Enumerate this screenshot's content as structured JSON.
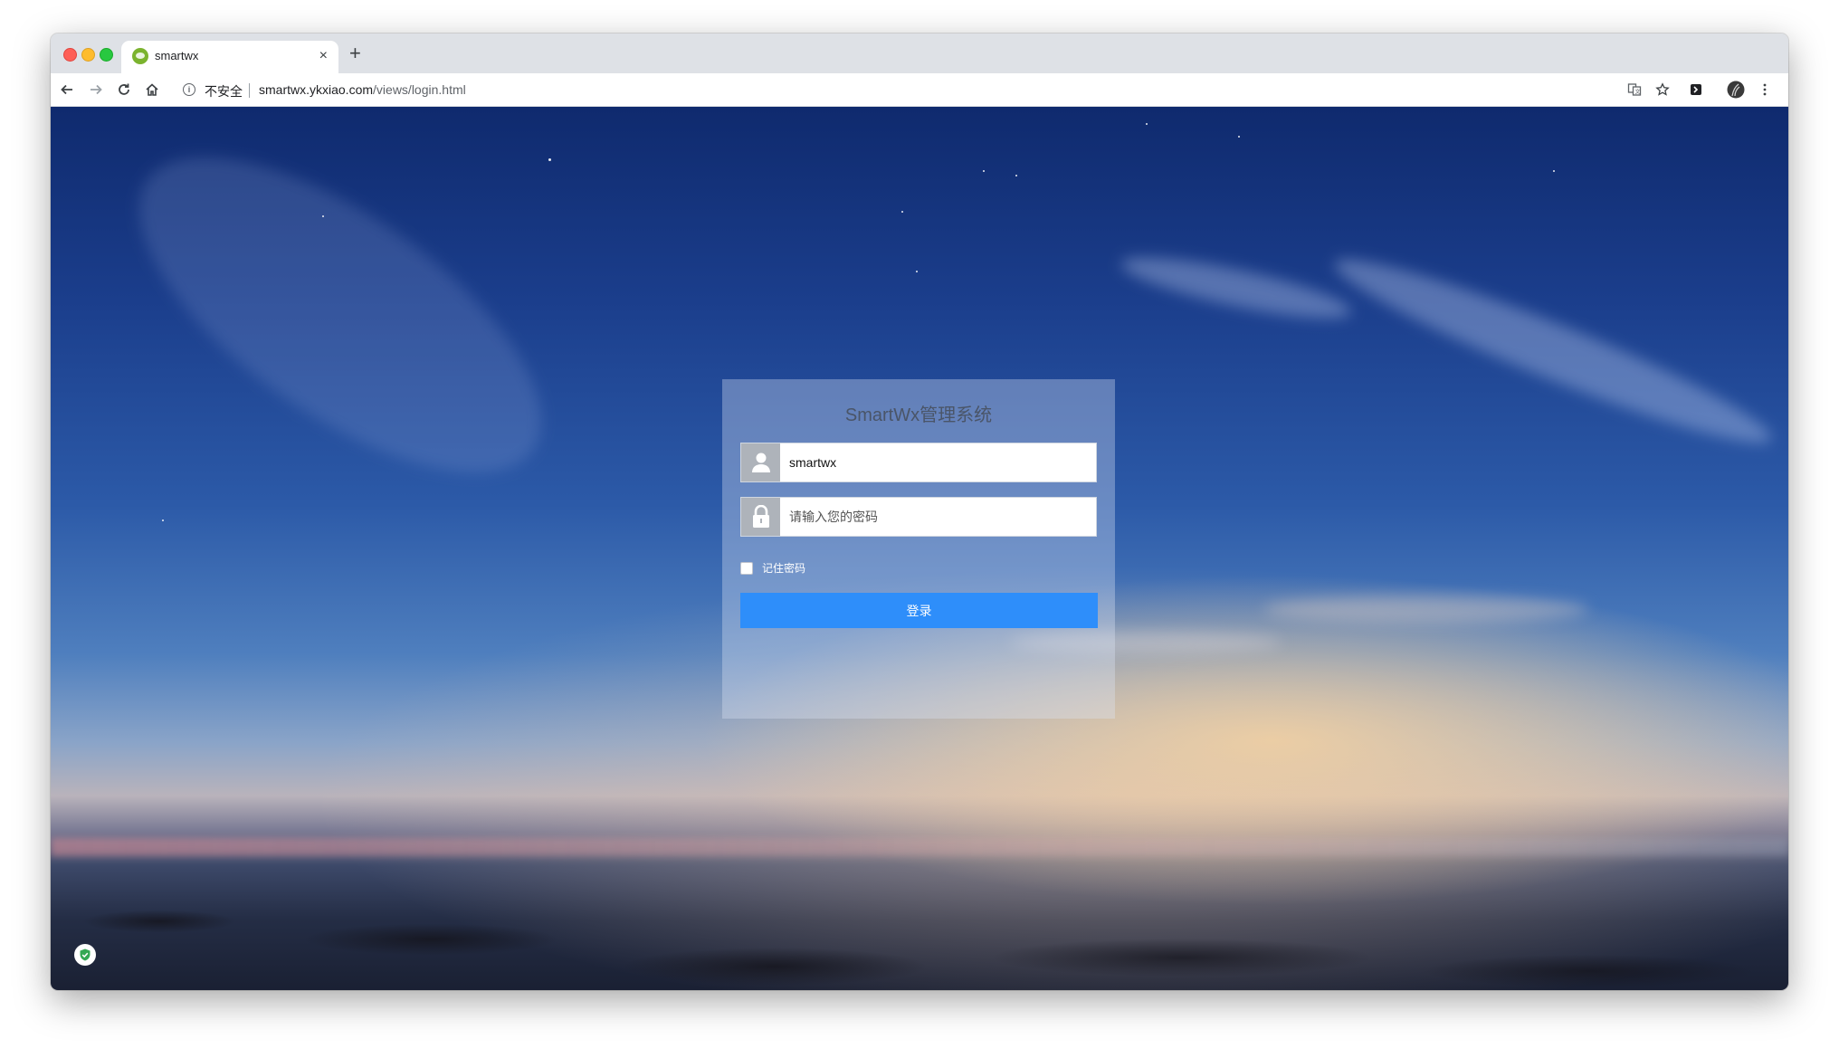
{
  "browser": {
    "tab_title": "smartwx",
    "tab_close": "×",
    "new_tab": "+",
    "security_label": "不安全",
    "url_host": "smartwx.ykxiao.com",
    "url_path": "/views/login.html",
    "icons": {
      "favicon": "wechat-icon",
      "back": "back-arrow-icon",
      "forward": "forward-arrow-icon",
      "reload": "reload-icon",
      "home": "home-icon",
      "info": "info-icon",
      "translate": "translate-icon",
      "bookmark": "star-icon",
      "extension": "extension-icon",
      "profile": "avatar",
      "menu": "kebab-menu-icon"
    }
  },
  "login": {
    "title": "SmartWx管理系统",
    "username_value": "smartwx",
    "password_placeholder": "请输入您的密码",
    "remember_label": "记住密码",
    "remember_checked": false,
    "submit_label": "登录",
    "icons": {
      "username": "user-icon",
      "password": "lock-icon"
    }
  },
  "colors": {
    "login_button": "#2e8efa",
    "field_icon_bg": "#aeb3ba"
  }
}
